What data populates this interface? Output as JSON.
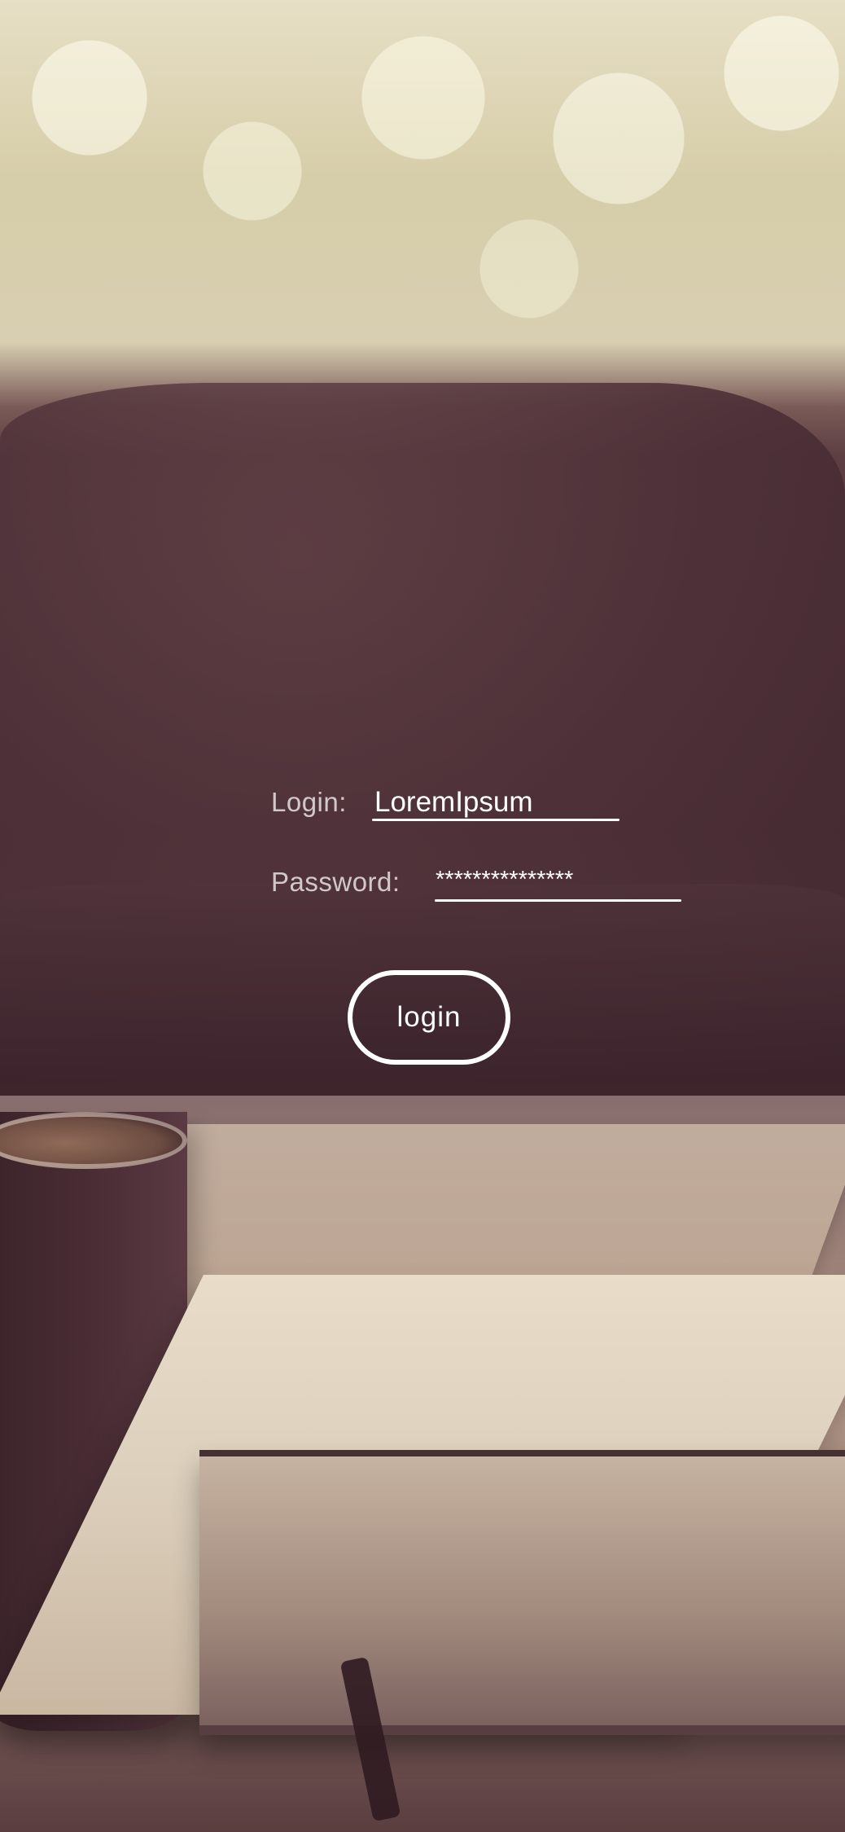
{
  "login": {
    "label": "Login:",
    "value": "LoremIpsum"
  },
  "password": {
    "label": "Password:",
    "value": "***************"
  },
  "button": {
    "label": "login"
  }
}
